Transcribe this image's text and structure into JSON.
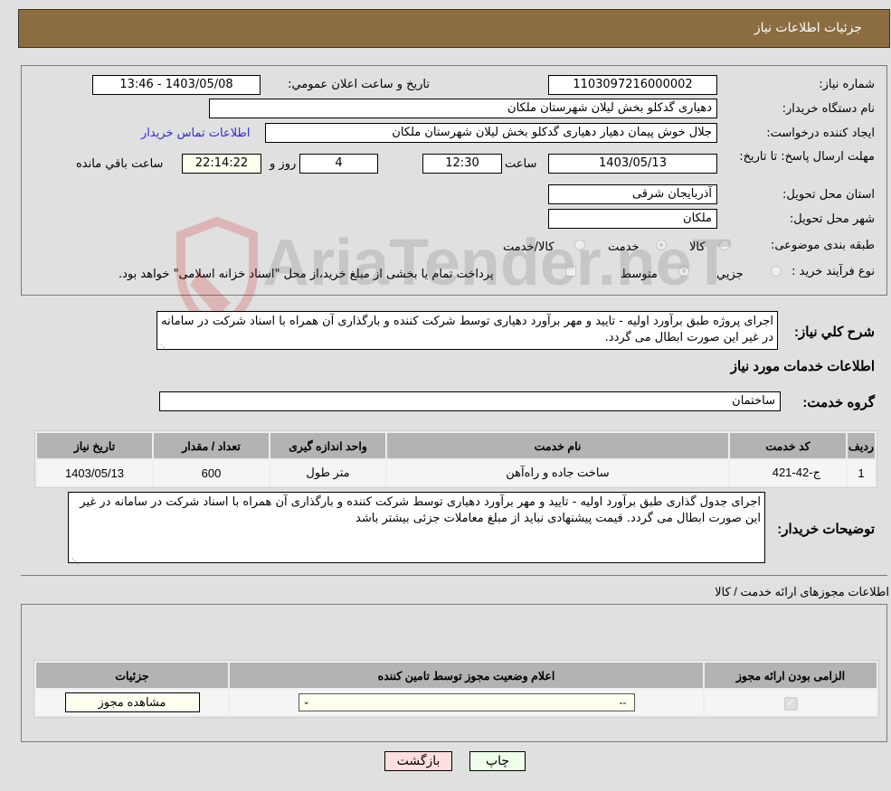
{
  "header": {
    "title": "جزئیات اطلاعات نیاز"
  },
  "form": {
    "need_number_label": "شماره نیاز:",
    "need_number": "1103097216000002",
    "announce_label": "تاریخ و ساعت اعلان عمومي:",
    "announce_value": "1403/05/08 - 13:46",
    "buyer_org_label": "نام دستگاه خریدار:",
    "buyer_org": "دهیاری گدکلو بخش لیلان شهرستان ملکان",
    "creator_label": "ایجاد کننده درخواست:",
    "creator": "جلال خوش پیمان دهیار دهیاری گدکلو بخش لیلان شهرستان ملکان",
    "contact_link": "اطلاعات تماس خریدار",
    "deadline_label": "مهلت ارسال پاسخ: تا تاریخ:",
    "deadline_date": "1403/05/13",
    "time_label": "ساعت",
    "deadline_time": "12:30",
    "days_value": "4",
    "days_label": "روز و",
    "remaining_time": "22:14:22",
    "remaining_label": "ساعت باقي مانده",
    "province_label": "استان محل تحویل:",
    "province": "آذربایجان شرقی",
    "city_label": "شهر محل تحویل:",
    "city": "ملکان",
    "category_label": "طبقه بندی موضوعی:",
    "category_options": [
      "کالا",
      "خدمت",
      "کالا/خدمت"
    ],
    "category_selected": "خدمت",
    "process_label": "نوع فرآیند خرید :",
    "process_options": [
      "جزيي",
      "متوسط"
    ],
    "process_selected": "متوسط",
    "treasury_note": "پرداخت تمام یا بخشی از مبلغ خرید،از محل \"اسناد خزانه اسلامی\" خواهد بود."
  },
  "description": {
    "label": "شرح کلي نیاز:",
    "text": "اجرای پروژه طبق برآورد اولیه - تایید و مهر برآورد دهیاری توسط شرکت کننده و بارگذاری آن همراه با اسناد شرکت در سامانه در غیر این صورت ابطال می گردد."
  },
  "services": {
    "section_title": "اطلاعات خدمات مورد نیاز",
    "group_label": "گروه خدمت:",
    "group_value": "ساختمان",
    "columns": [
      "ردیف",
      "کد خدمت",
      "نام خدمت",
      "واحد اندازه گیری",
      "تعداد / مقدار",
      "تاریخ نیاز"
    ],
    "rows": [
      [
        "1",
        "ج-42-421",
        "ساخت جاده و راه‌آهن",
        "متر طول",
        "600",
        "1403/05/13"
      ]
    ]
  },
  "buyer_notes": {
    "label": "توضیحات خریدار:",
    "text": "اجرای جدول گذاری طبق برآورد اولیه - تایید و مهر برآورد دهیاری توسط شرکت کننده و بارگذاری آن همراه با اسناد شرکت در سامانه در غیر این صورت ابطال می گردد. قیمت پیشنهادی نباید از مبلغ معاملات جزئی بیشتر باشد"
  },
  "permits": {
    "section_title": "اطلاعات مجوزهای ارائه خدمت / کالا",
    "columns": [
      "الزامی بودن ارائه مجوز",
      "اعلام وضعیت مجوز توسط تامین کننده",
      "جزئیات"
    ],
    "row": {
      "required_checked": true,
      "status_value": "--",
      "details_button": "مشاهده مجوز"
    }
  },
  "buttons": {
    "print": "چاپ",
    "back": "بازگشت"
  },
  "watermark": "AriaTender.neT"
}
